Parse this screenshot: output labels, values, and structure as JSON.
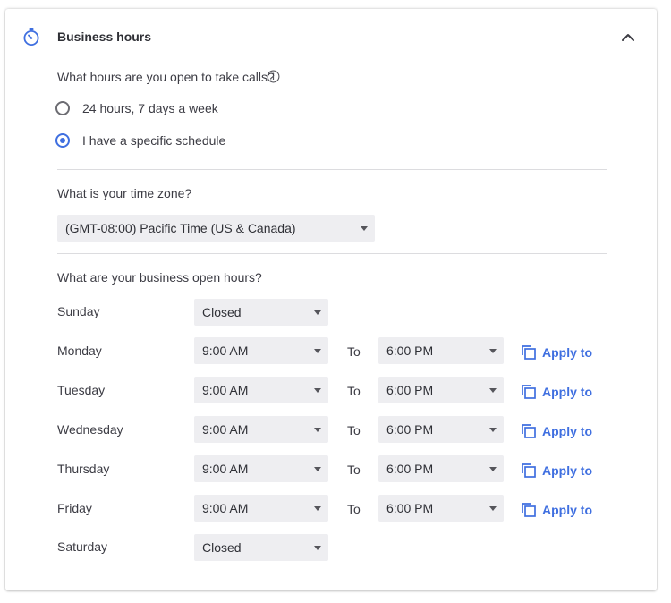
{
  "section": {
    "title": "Business hours",
    "icon": "timer-icon",
    "collapse_icon": "chevron-up-icon"
  },
  "hours_question": "What hours are you open to take calls?",
  "radios": [
    {
      "label": "24 hours, 7 days a week",
      "checked": false
    },
    {
      "label": "I have a specific schedule",
      "checked": true
    }
  ],
  "timezone": {
    "question": "What is your time zone?",
    "value": "(GMT-08:00) Pacific Time (US & Canada)"
  },
  "open_hours_question": "What are your business open hours?",
  "to_label": "To",
  "apply_label": "Apply to",
  "schedule": [
    {
      "day": "Sunday",
      "status": "Closed"
    },
    {
      "day": "Monday",
      "open": "9:00 AM",
      "close": "6:00 PM"
    },
    {
      "day": "Tuesday",
      "open": "9:00 AM",
      "close": "6:00 PM"
    },
    {
      "day": "Wednesday",
      "open": "9:00 AM",
      "close": "6:00 PM"
    },
    {
      "day": "Thursday",
      "open": "9:00 AM",
      "close": "6:00 PM"
    },
    {
      "day": "Friday",
      "open": "9:00 AM",
      "close": "6:00 PM"
    },
    {
      "day": "Saturday",
      "status": "Closed"
    }
  ],
  "colors": {
    "accent": "#3f6fe0",
    "select_bg": "#eeeef1",
    "text": "#3c3c44"
  }
}
